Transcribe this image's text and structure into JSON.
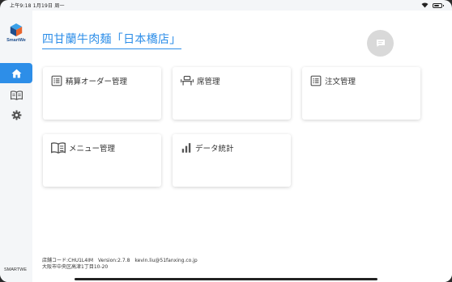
{
  "status_bar": {
    "time_date": "上午9:18  1月19日 周一",
    "battery_percent": 80
  },
  "sidebar": {
    "logo_text": "SmartWe",
    "items": [
      {
        "icon": "home-icon",
        "active": true
      },
      {
        "icon": "book-icon",
        "active": false
      },
      {
        "icon": "gear-icon",
        "active": false
      }
    ],
    "footer_label": "SMARTWE"
  },
  "header": {
    "title": "四甘蘭牛肉麺「日本橋店」"
  },
  "cards": [
    {
      "label": "精算オーダー管理",
      "icon": "list-icon"
    },
    {
      "label": "席管理",
      "icon": "seat-icon"
    },
    {
      "label": "注文管理",
      "icon": "list-icon"
    },
    {
      "label": "メニュー管理",
      "icon": "menu-book-icon"
    },
    {
      "label": "データ統計",
      "icon": "bar-chart-icon"
    }
  ],
  "footer": {
    "store_code": "店舗コード:CHU1L4IM",
    "version": "Version:2.7.8",
    "email": "kevin.liu@51fanxing.co.jp",
    "address": "大阪市中央区高津1丁目10-20"
  },
  "colors": {
    "accent": "#2d8ee8",
    "sidebar_bg": "#f4f6f8",
    "card_bg": "#ffffff"
  }
}
